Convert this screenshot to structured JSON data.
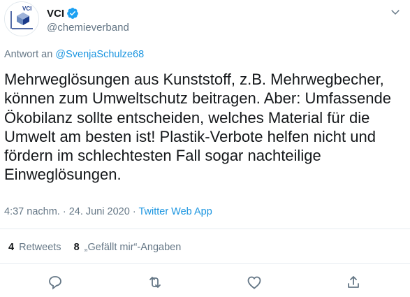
{
  "account": {
    "display_name": "VCI",
    "handle": "@chemieverband",
    "logo_text": "VCI"
  },
  "reply": {
    "prefix": "Antwort an",
    "mention": "@SvenjaSchulze68"
  },
  "tweet": {
    "text": "Mehrweglösungen aus Kunststoff, z.B. Mehrwegbecher, können zum Umweltschutz beitragen. Aber: Umfassende Ökobilanz sollte entscheiden, welches Material für die Umwelt am besten ist! Plastik-Verbote helfen nicht und fördern im schlechtesten Fall sogar nachteilige Einweglösungen.",
    "time": "4:37 nachm.",
    "separator": "·",
    "date": "24. Juni 2020",
    "source": "Twitter Web App"
  },
  "stats": {
    "retweets_count": "4",
    "retweets_label": "Retweets",
    "likes_count": "8",
    "likes_label": "„Gefällt mir“-Angaben"
  },
  "colors": {
    "link": "#1b95e0",
    "secondary_text": "#657786",
    "primary_text": "#14171a",
    "verified": "#1da1f2"
  },
  "icons": [
    "verified-badge-icon",
    "chevron-down-icon",
    "reply-icon",
    "retweet-icon",
    "like-icon",
    "share-icon"
  ]
}
